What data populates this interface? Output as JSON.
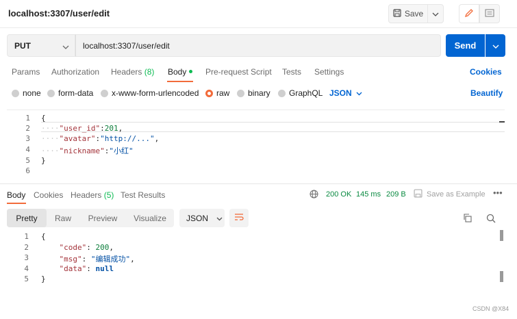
{
  "title": "localhost:3307/user/edit",
  "toolbar": {
    "save_label": "Save"
  },
  "request": {
    "method": "PUT",
    "url": "localhost:3307/user/edit",
    "send_label": "Send"
  },
  "request_tabs": [
    {
      "label": "Params"
    },
    {
      "label": "Authorization"
    },
    {
      "label": "Headers",
      "count": "(8)"
    },
    {
      "label": "Body"
    },
    {
      "label": "Pre-request Script"
    },
    {
      "label": "Tests"
    },
    {
      "label": "Settings"
    }
  ],
  "cookies_label": "Cookies",
  "body_types": [
    "none",
    "form-data",
    "x-www-form-urlencoded",
    "raw",
    "binary",
    "GraphQL"
  ],
  "body_format": "JSON",
  "beautify_label": "Beautify",
  "request_body": {
    "line_numbers": [
      "1",
      "2",
      "3",
      "4",
      "5",
      "6"
    ],
    "open": "{",
    "close": "}",
    "k1": "\"user_id\"",
    "v1": "201",
    "k2": "\"avatar\"",
    "v2": "\"http://...\"",
    "k3": "\"nickname\"",
    "v3": "\"小红\""
  },
  "response_tabs": [
    {
      "label": "Body"
    },
    {
      "label": "Cookies"
    },
    {
      "label": "Headers",
      "count": "(5)"
    },
    {
      "label": "Test Results"
    }
  ],
  "response_meta": {
    "status": "200 OK",
    "time": "145 ms",
    "size": "209 B",
    "save_example": "Save as Example"
  },
  "view_modes": [
    "Pretty",
    "Raw",
    "Preview",
    "Visualize"
  ],
  "response_format": "JSON",
  "response_body": {
    "line_numbers": [
      "1",
      "2",
      "3",
      "4",
      "5"
    ],
    "open": "{",
    "close": "}",
    "k1": "\"code\"",
    "v1": "200",
    "k2": "\"msg\"",
    "v2": "\"编辑成功\"",
    "k3": "\"data\"",
    "v3": "null"
  },
  "watermark": "CSDN @X84",
  "colors": {
    "accent": "#f26b3a",
    "primary": "#0265d2",
    "success": "#0cbb52"
  }
}
